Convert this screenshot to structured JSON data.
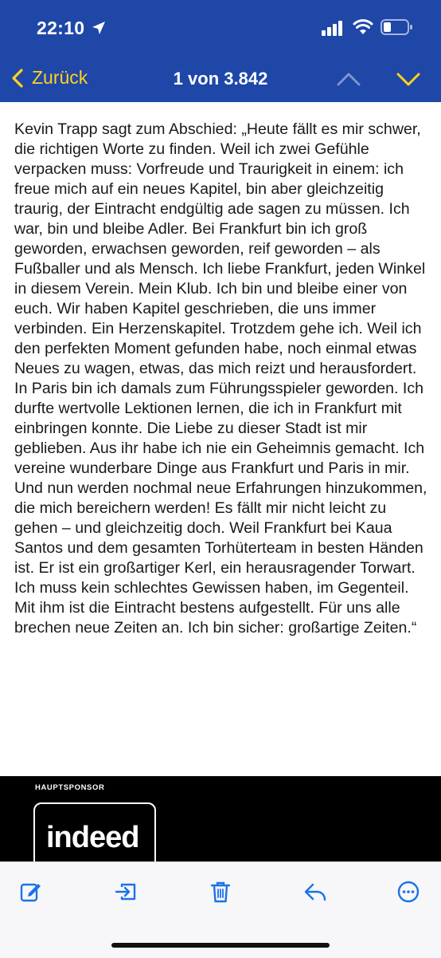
{
  "status_bar": {
    "time": "22:10"
  },
  "nav": {
    "back_label": "Zurück",
    "counter": "1 von 3.842"
  },
  "article": {
    "body": "Kevin Trapp sagt zum Abschied: „Heute fällt es mir schwer, die richtigen Worte zu finden. Weil ich zwei Gefühle verpacken muss: Vorfreude und Traurigkeit in einem: ich freue mich auf ein neues Kapitel, bin aber gleichzeitig traurig, der Eintracht endgültig ade sagen zu müssen. Ich war, bin und bleibe Adler. Bei Frankfurt bin ich groß geworden, erwachsen geworden, reif geworden – als Fußballer und als Mensch. Ich liebe Frankfurt, jeden Winkel in diesem Verein. Mein Klub. Ich bin und bleibe einer von euch. Wir haben Kapitel geschrieben, die uns immer verbinden. Ein Herzenskapitel. Trotzdem gehe ich. Weil ich den perfekten Moment gefunden habe, noch einmal etwas Neues zu wagen, etwas, das mich reizt und herausfordert. In Paris bin ich damals zum Führungsspieler geworden. Ich durfte wertvolle Lektionen lernen, die ich in Frankfurt mit einbringen konnte. Die Liebe zu dieser Stadt ist mir geblieben. Aus ihr habe ich nie ein Geheimnis gemacht. Ich vereine wunderbare Dinge aus Frankfurt und Paris in mir. Und nun werden nochmal neue Erfahrungen hinzukommen, die mich bereichern werden! Es fällt mir nicht leicht zu gehen – und gleichzeitig doch. Weil Frankfurt bei Kaua Santos und dem gesamten Torhüterteam in besten Händen ist. Er ist ein großartiger Kerl, ein herausragender Torwart. Ich muss kein schlechtes Gewissen haben, im Gegenteil. Mit ihm ist die Eintracht bestens aufgestellt. Für uns alle brechen neue Zeiten an. Ich bin sicher: großartige Zeiten.“"
  },
  "sponsor": {
    "label": "HAUPTSPONSOR",
    "logo_text": "indeed"
  },
  "toolbar": {
    "icons": [
      "compose-icon",
      "move-to-folder-icon",
      "trash-icon",
      "reply-icon",
      "more-icon"
    ]
  },
  "colors": {
    "header_bg": "#1f47a8",
    "accent_yellow": "#ffd21f",
    "toolbar_blue": "#1a73e8"
  }
}
